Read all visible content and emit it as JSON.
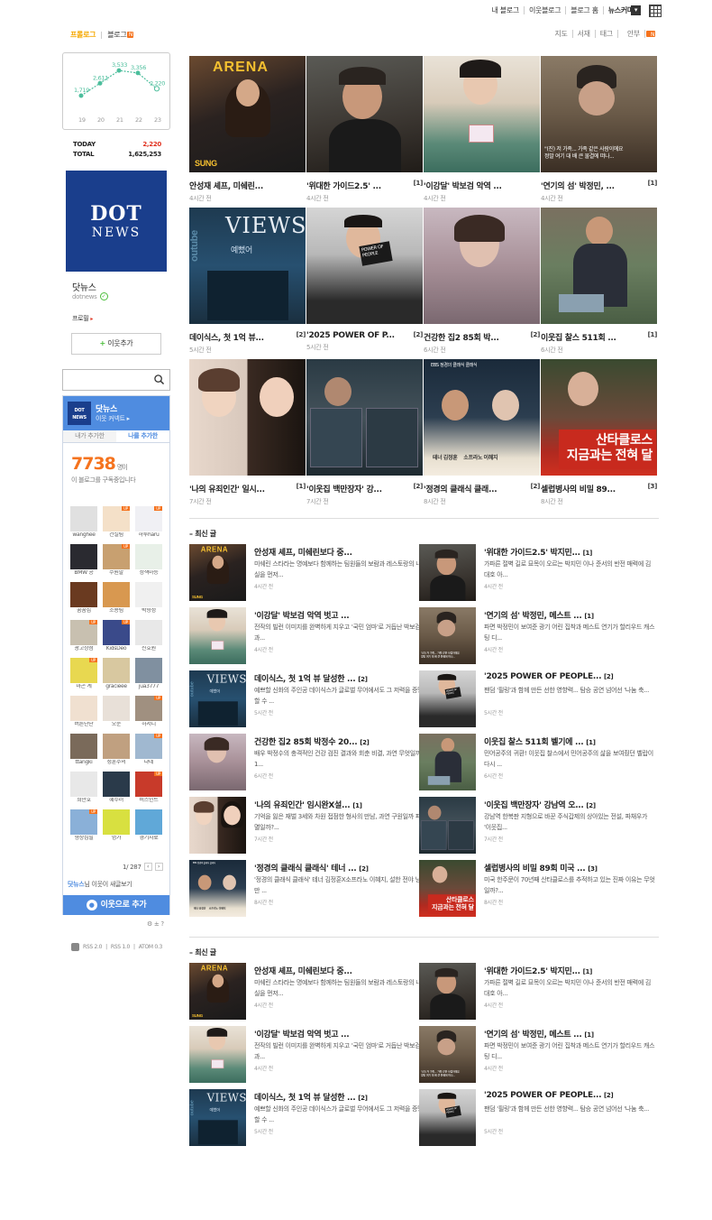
{
  "top_links": [
    "내 블로그",
    "이웃블로그",
    "블로그 홈",
    "뉴스커머"
  ],
  "blog_tabs": {
    "active": "프롤로그",
    "blog": "블로그"
  },
  "right_nav": [
    "지도",
    "서재",
    "태그",
    "안부"
  ],
  "visitor": {
    "days": [
      "19",
      "20",
      "21",
      "22",
      "23"
    ],
    "counts": [
      1719,
      2611,
      3533,
      3356,
      2220
    ],
    "count_labels": [
      "1,719",
      "2,611",
      "3,533",
      "3,356",
      "2,220"
    ],
    "today_label": "TODAY",
    "today": "2,220",
    "total_label": "TOTAL",
    "total": "1,625,253"
  },
  "profile": {
    "logo_line1": "DOT",
    "logo_line2": "NEWS",
    "name": "닷뉴스",
    "id": "dotnews",
    "menu": "프로필",
    "add_neighbor": "이웃추가"
  },
  "neighbor": {
    "title": "닷뉴스",
    "subtitle": "이웃 커넥트",
    "tabs": [
      "내가 추가한",
      "나를 추가한"
    ],
    "count": "7738",
    "count_unit": "명이",
    "sub": "이 블로그를 구독중입니다",
    "names": [
      "wanghee",
      "건설팀",
      "하루haru",
      "BMW 공",
      "수원발",
      "정책마등",
      "꿈꿈집",
      "조용팀",
      "박향정",
      "광고상점",
      "KidsDeo",
      "신호원",
      "마곤 계",
      "gracieee",
      "jua3777",
      "버튼단단",
      "오운",
      "하서니",
      "ttangki",
      "성훈주의",
      "냐네",
      "희만호",
      "혜수러",
      "비즈인트",
      "형상집필",
      "명가",
      "경기자료"
    ],
    "paging": "1/ 287",
    "invite_name": "닷뉴스",
    "invite_rest": "님 이웃이 새글보기",
    "add_button": "이웃으로 추가",
    "gear": "⚙ ± ?"
  },
  "rss": [
    "RSS 2.0",
    "RSS 1.0",
    "ATOM 0.3"
  ],
  "grid": [
    {
      "title": "안성재 셰프, 미쉐린...",
      "count": "",
      "time": "4시간 전"
    },
    {
      "title": "'위대한 가이드2.5' ...",
      "count": "[1]",
      "time": "4시간 전"
    },
    {
      "title": "'이강달' 박보검 악역 ...",
      "count": "",
      "time": "4시간 전"
    },
    {
      "title": "'연기의 섬' 박정민, ...",
      "count": "[1]",
      "time": "4시간 전"
    },
    {
      "title": "데이식스, 첫 1억 뷰...",
      "count": "[2]",
      "time": "5시간 전"
    },
    {
      "title": "'2025 POWER OF P...",
      "count": "[2]",
      "time": "5시간 전"
    },
    {
      "title": "건강한 집2 85회 박...",
      "count": "[2]",
      "time": "6시간 전"
    },
    {
      "title": "이웃집 찰스 511회 ...",
      "count": "[1]",
      "time": "6시간 전"
    },
    {
      "title": "'나의 유죄인간' 일시...",
      "count": "[1]",
      "time": "7시간 전"
    },
    {
      "title": "'이웃집 백만장자' 강...",
      "count": "[2]",
      "time": "7시간 전"
    },
    {
      "title": "'정경의 클래식 클래...",
      "count": "[2]",
      "time": "8시간 전"
    },
    {
      "title": "셀럽병사의 비밀 89...",
      "count": "[3]",
      "time": "8시간 전"
    }
  ],
  "section1_title": "최신 글",
  "section2_title": "최신 글",
  "list": [
    {
      "title": "안성재 셰프, 미쉐린보다 중...",
      "count": "",
      "desc": "미쉐린 스타라는 명예보다 함께하는 팀원들의 보람과 레스토랑의 내실을 먼저...",
      "time": "4시간 전"
    },
    {
      "title": "'위대한 가이드2.5' 박지민...",
      "count": "[1]",
      "desc": "가파른 절벽 길로 묘목이 오르는 박지민 이나 준서의 반전 매력에 김대호 아...",
      "time": "4시간 전"
    },
    {
      "title": "'이강달' 박보검 악역 벗고 ...",
      "count": "",
      "desc": "전작의 빌런 이미지를 완벽하게 지우고 '국민 엄마'로 거듭난 박보검, 과...",
      "time": "4시간 전"
    },
    {
      "title": "'연기의 섬' 박정민, 메스트 ...",
      "count": "[1]",
      "desc": "파면 박정민이 보여준 광기 어린 집착과 메스트 연기가 할리우드 캐스팅 디...",
      "time": "4시간 전"
    },
    {
      "title": "데이식스, 첫 1억 뷰 달성한 ...",
      "count": "[2]",
      "desc": "예쁘할 신화의 주인공 데이식스가 글로벌 무어에서도 그 저력을 증명할 수 ...",
      "time": "5시간 전"
    },
    {
      "title": "'2025 POWER OF PEOPLE...",
      "count": "[2]",
      "desc": "팬덤 '필링'과 함께 만든 선한 영향력... 탐승 공연 넘어선 '나눔 축...",
      "time": "5시간 전"
    },
    {
      "title": "건강한 집2 85회 박정수 20...",
      "count": "[2]",
      "desc": "배우 박정수의 충격적인 건강 검진 결과와 회춘 비결, 과연 무엇일까? 1...",
      "time": "6시간 전"
    },
    {
      "title": "이웃집 찰스 511회 벨기에 ...",
      "count": "[1]",
      "desc": "민어공주의 귀환! 이웃집 찰스에서 민어공주의 삶을 보여줬던 벨랍이 다시 ...",
      "time": "6시간 전"
    },
    {
      "title": "'나의 유죄인간' 임시완X설...",
      "count": "[1]",
      "desc": "기억을 잃은 재벌 3세와 차원 접점한 형사의 만남, 과연 구원일까 파멸일까?...",
      "time": "7시간 전"
    },
    {
      "title": "'이웃집 백만장자' 강남역 오...",
      "count": "[2]",
      "desc": "강남역 한복판 지형으로 바꾼 주식갑제의 상아있는 전설, 파채우가 '이웃집...",
      "time": "7시간 전"
    },
    {
      "title": "'정경의 클래식 클래식' 테너 ...",
      "count": "[2]",
      "desc": "'정경의 클래식 클래식' 테너 김정훈X소프라노 이혜지, 설한 전야 낭만 ...",
      "time": "8시간 전"
    },
    {
      "title": "셀럽병사의 비밀 89회 미국 ...",
      "count": "[3]",
      "desc": "미국 한주문이 70년째 산타클로스를 추적하고 있는 진짜 이유는 무엇일까?...",
      "time": "8시간 전"
    }
  ],
  "colors": {
    "accent": "#f5a800",
    "blue": "#4f8ce0",
    "orange": "#f5731e",
    "green": "#4cbe3c"
  }
}
